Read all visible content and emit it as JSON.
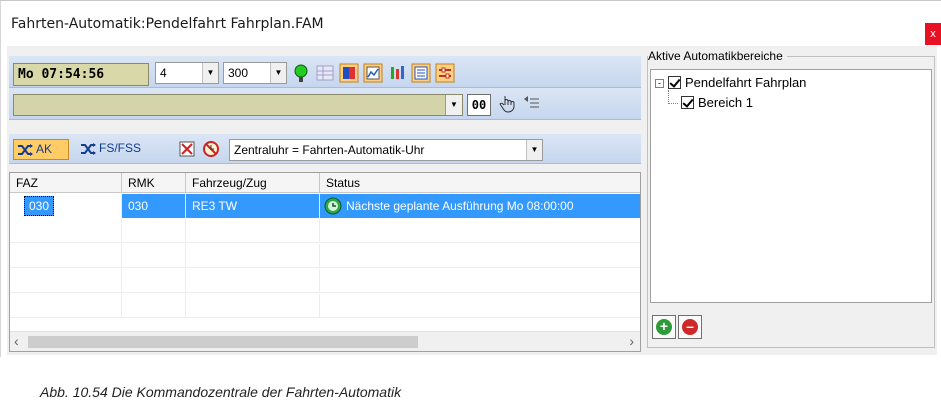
{
  "window": {
    "title": "Fahrten-Automatik:Pendelfahrt Fahrplan.FAM",
    "close_label": "x"
  },
  "toolbar1": {
    "clock": "Mo  07:54:56",
    "combo1_value": "4",
    "combo2_value": "300",
    "icons": [
      "green-lamp-icon",
      "grid-view-icon",
      "red-panel-icon",
      "chart-icon",
      "sliders-icon",
      "list-view-icon",
      "settings-panel-icon"
    ]
  },
  "toolbar2": {
    "selector_value": "",
    "counter": "00",
    "icons": [
      "hand-cursor-icon",
      "indent-list-icon"
    ]
  },
  "toolbar3": {
    "ak_label": "AK",
    "fs_label": "FS/FSS",
    "clock_source": "Zentraluhr = Fahrten-Automatik-Uhr",
    "icons": [
      "shuffle-icon",
      "shuffle-icon",
      "stop-icon",
      "no-clock-icon"
    ]
  },
  "grid": {
    "columns": [
      "FAZ",
      "RMK",
      "Fahrzeug/Zug",
      "Status"
    ],
    "rows": [
      {
        "faz": "030",
        "rmk": "030",
        "train": "RE3 TW",
        "status": "Nächste geplante Ausführung Mo 08:00:00"
      }
    ]
  },
  "right_panel": {
    "group_label": "Aktive Automatikbereiche",
    "tree": [
      {
        "label": "Pendelfahrt Fahrplan",
        "checked": true,
        "expander": "-"
      },
      {
        "label": "Bereich 1",
        "checked": true
      }
    ],
    "add_symbol": "+",
    "remove_symbol": "–"
  },
  "caption": "Abb. 10.54  Die Kommandozentrale der Fahrten-Automatik"
}
